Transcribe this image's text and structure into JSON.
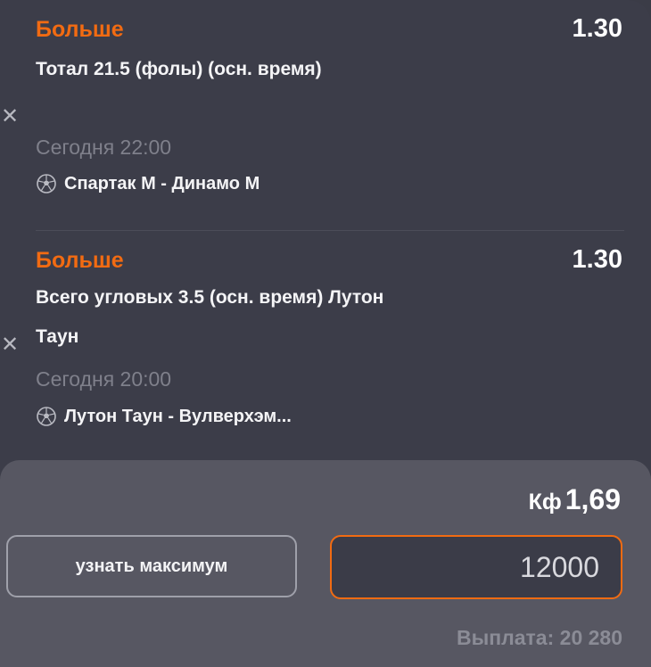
{
  "bets": [
    {
      "outcome": "Больше",
      "odds": "1.30",
      "market": "Тотал 21.5 (фолы) (осн. время)",
      "time": "Сегодня 22:00",
      "match": "Спартак М - Динамо М"
    },
    {
      "outcome": "Больше",
      "odds": "1.30",
      "market": "Всего угловых 3.5 (осн. время) Лутон Таун",
      "time": "Сегодня 20:00",
      "match": "Лутон Таун - Вулверхэм..."
    }
  ],
  "icons": {
    "remove": "close-icon",
    "sport": "soccer-ball-icon"
  },
  "footer": {
    "coef_label": "Кф",
    "coef_value": "1,69",
    "max_button_label": "узнать максимум",
    "stake_value": "12000",
    "payout": "Выплата: 20 280"
  },
  "colors": {
    "accent": "#f26b12",
    "panel": "#3c3d49",
    "footer": "#575762"
  }
}
